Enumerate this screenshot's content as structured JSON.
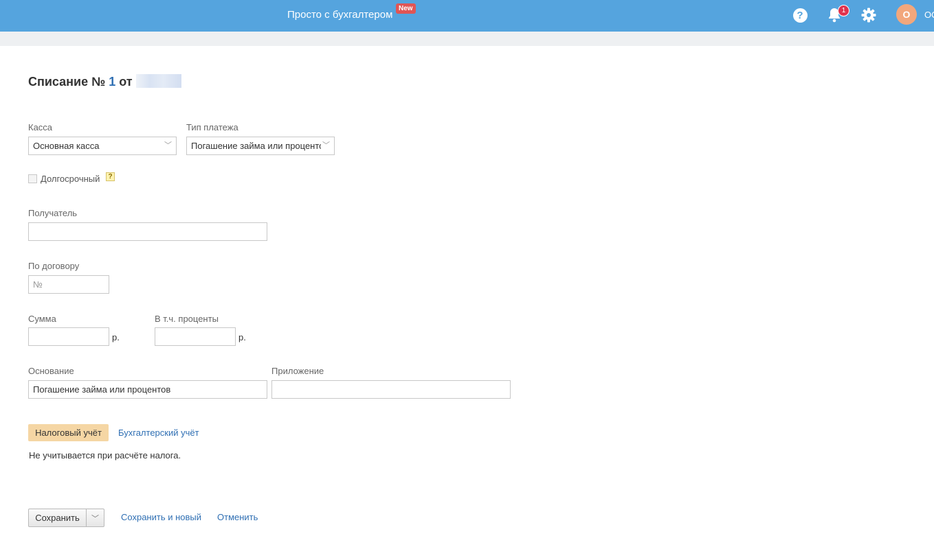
{
  "header": {
    "brand": "Просто с бухгалтером",
    "new_badge": "New",
    "help_symbol": "?",
    "notification_count": "1",
    "avatar_letter": "О",
    "user_name": "ОО",
    "colors": {
      "bar": "#55a4de",
      "badge": "#e05555",
      "notif": "#e0334d",
      "avatar": "#f2a77c"
    },
    "icons": [
      "help-icon",
      "bell-icon",
      "gear-icon"
    ]
  },
  "form": {
    "title_prefix": "Списание №",
    "number": "1",
    "title_from": "от",
    "kassa_label": "Касса",
    "kassa_value": "Основная касса",
    "payment_type_label": "Тип платежа",
    "payment_type_value": "Погашение займа или процентов",
    "long_term_label": "Долгосрочный",
    "long_term_help": "?",
    "recipient_label": "Получатель",
    "recipient_value": "",
    "contract_label": "По договору",
    "contract_placeholder": "№",
    "sum_label": "Сумма",
    "sum_value": "",
    "sum_unit": "р.",
    "interest_label": "В т.ч. проценты",
    "interest_value": "",
    "interest_unit": "р.",
    "basis_label": "Основание",
    "basis_value": "Погашение займа или процентов",
    "attachment_label": "Приложение",
    "attachment_value": ""
  },
  "tabs": {
    "tax": "Налоговый учёт",
    "accounting": "Бухгалтерский учёт",
    "tax_note": "Не учитывается при расчёте налога."
  },
  "actions": {
    "save": "Сохранить",
    "save_and_new": "Сохранить и новый",
    "cancel": "Отменить"
  }
}
